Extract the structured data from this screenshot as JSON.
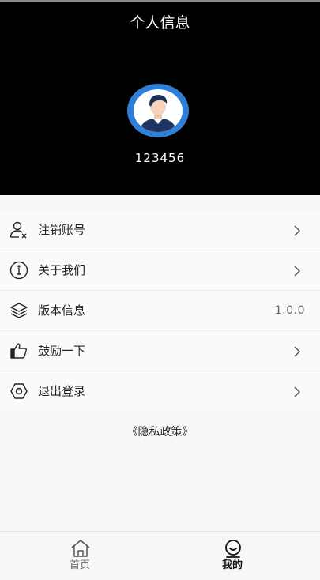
{
  "header": {
    "title": "个人信息",
    "username": "123456"
  },
  "menu": {
    "items": [
      {
        "label": "注销账号",
        "icon": "user-remove-icon"
      },
      {
        "label": "关于我们",
        "icon": "info-icon"
      },
      {
        "label": "版本信息",
        "icon": "layers-icon",
        "value": "1.0.0"
      },
      {
        "label": "鼓励一下",
        "icon": "thumbs-up-icon"
      },
      {
        "label": "退出登录",
        "icon": "hexagon-settings-icon"
      }
    ]
  },
  "privacy_link": "《隐私政策》",
  "tabbar": {
    "tabs": [
      {
        "label": "首页",
        "icon": "home-icon",
        "active": false
      },
      {
        "label": "我的",
        "icon": "profile-icon",
        "active": true
      }
    ]
  },
  "colors": {
    "header_bg": "#000000",
    "avatar_ring": "#2f7fd6",
    "active_tab": "#111111",
    "inactive_tab": "#666666"
  }
}
